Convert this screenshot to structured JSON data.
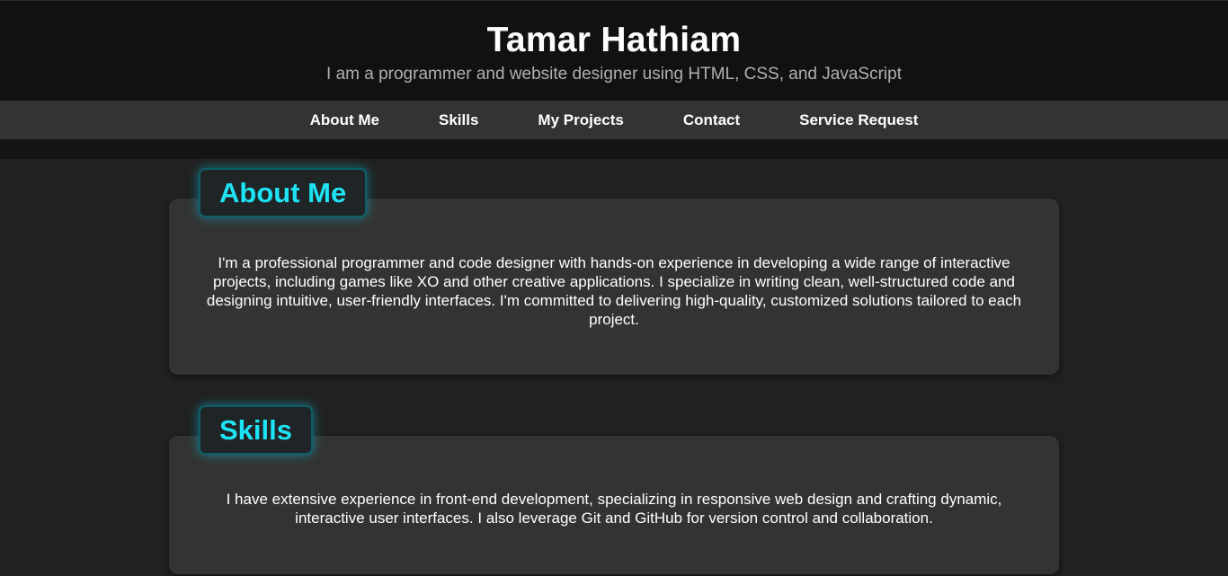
{
  "header": {
    "title": "Tamar Hathiam",
    "subtitle": "I am a programmer and website designer using HTML, CSS, and JavaScript"
  },
  "nav": {
    "items": [
      {
        "label": "About Me"
      },
      {
        "label": "Skills"
      },
      {
        "label": "My Projects"
      },
      {
        "label": "Contact"
      },
      {
        "label": "Service Request"
      }
    ]
  },
  "sections": {
    "about": {
      "title": "About Me",
      "text": "I'm a professional programmer and code designer with hands-on experience in developing a wide range of interactive projects, including games like XO and other creative applications. I specialize in writing clean, well-structured code and designing intuitive, user-friendly interfaces. I'm committed to delivering high-quality, customized solutions tailored to each project."
    },
    "skills": {
      "title": "Skills",
      "text": "I have extensive experience in front-end development, specializing in responsive web design and crafting dynamic, interactive user interfaces. I also leverage Git and GitHub for version control and collaboration."
    }
  },
  "colors": {
    "accent": "#1ee3f5",
    "header_bg": "#111111",
    "nav_bg": "#333333",
    "page_bg": "#212121",
    "card_bg": "#333333"
  }
}
